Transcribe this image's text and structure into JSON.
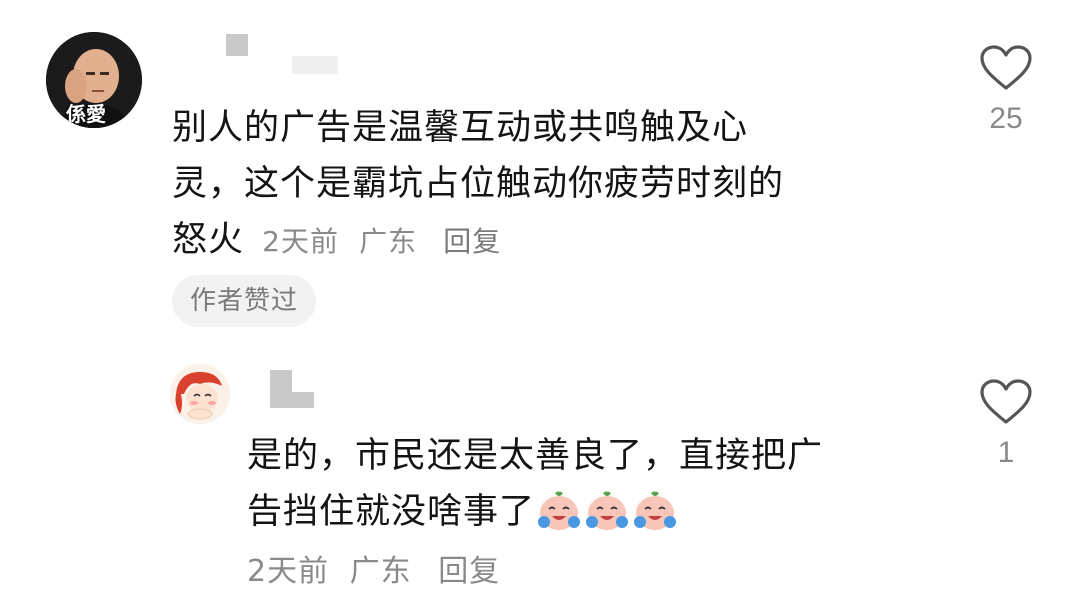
{
  "comment": {
    "text": "别人的广告是温馨互动或共鸣触及心灵，这个是霸坑占位触动你疲劳时刻的怒火",
    "line1": "别人的广告是温馨互动或共鸣触及心",
    "line2": "灵，这个是霸坑占位触动你疲劳时刻的",
    "line3": "怒火",
    "time": "2天前",
    "location": "广东",
    "reply_label": "回复",
    "author_liked_label": "作者赞过",
    "like_count": "25",
    "avatar_text": "係愛"
  },
  "reply": {
    "line1": "是的，市民还是太善良了，直接把广",
    "line2": "告挡住就没啥事了",
    "emojis": [
      "crying-laugh-emoji",
      "crying-laugh-emoji",
      "crying-laugh-emoji"
    ],
    "time": "2天前",
    "location": "广东",
    "reply_label": "回复",
    "like_count": "1"
  },
  "icons": {
    "like": "heart-outline-icon"
  },
  "colors": {
    "text": "#141414",
    "meta": "#8a8a8a",
    "pill_bg": "#f2f2f2",
    "icon": "#555555"
  }
}
